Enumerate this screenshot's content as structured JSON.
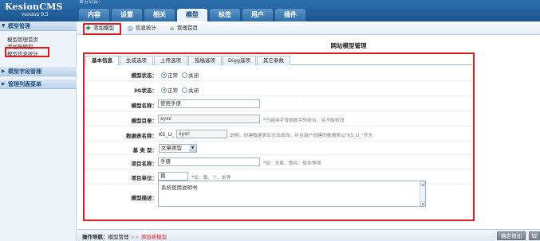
{
  "app": {
    "logo_title": "KesionCMS",
    "logo_version": "version 9.5",
    "top_note": "官方公告："
  },
  "nav": {
    "tabs": [
      "内容",
      "设置",
      "相关",
      "模型",
      "标签",
      "用户",
      "插件"
    ],
    "active": "模型"
  },
  "sidebar": {
    "sections": [
      {
        "title": "模型管理",
        "items": [
          "模型管理首页",
          "添加新模型",
          "模型信息统计"
        ]
      },
      {
        "title": "模型字段管理",
        "items": []
      },
      {
        "title": "管理列表菜单",
        "items": []
      }
    ],
    "highlighted_item": "添加新模型"
  },
  "toolbar": {
    "add_model": "添加模型",
    "info_stats": "信息统计",
    "manage_home": "管理首页"
  },
  "page": {
    "heading": "网站模型管理"
  },
  "content_tabs": [
    "基本信息",
    "生成选项",
    "上传选项",
    "投稿选项",
    "Digg选项",
    "其它参数"
  ],
  "form": {
    "model_status": {
      "label": "模型状态：",
      "options": [
        "正常",
        "关闭"
      ],
      "selected": "正常"
    },
    "model_3g": {
      "label": "3G状态：",
      "options": [
        "正常",
        "关闭"
      ],
      "selected": "正常"
    },
    "model_name": {
      "label": "模型名称：",
      "value": "使用手册"
    },
    "model_dir": {
      "label": "模型目录：",
      "value": "sysc",
      "hint": "*只能用字母和数字的组合，且不能修改"
    },
    "table_name": {
      "label": "数据表名称：",
      "prefix": "KS_U_",
      "value": "sysc",
      "hint": "说明：创建数据表后无法修改，并且用户创建的数据表以\"KS_U_\"开头"
    },
    "base_type": {
      "label": "基 类 型：",
      "value": "文章类型"
    },
    "item_name": {
      "label": "项目名称：",
      "value": "手册",
      "hint": "*如：文章、图片、软件等项"
    },
    "item_unit": {
      "label": "项目单位：",
      "value": "篇",
      "hint": "*如：篇、个、本等"
    },
    "model_desc": {
      "label": "模型描述：",
      "value": "系统使用说明书"
    }
  },
  "footer": {
    "crumb_label": "操作导航：",
    "crumb_parent": "模型管理",
    "crumb_sep": ">>",
    "crumb_current": "添加新模型",
    "confirm_button": "确定增加",
    "cancel_button": "取"
  },
  "colors": {
    "header_bg": "#1b5590",
    "highlight_border": "#e0191b",
    "sidebar_bg": "#eef4fa"
  }
}
